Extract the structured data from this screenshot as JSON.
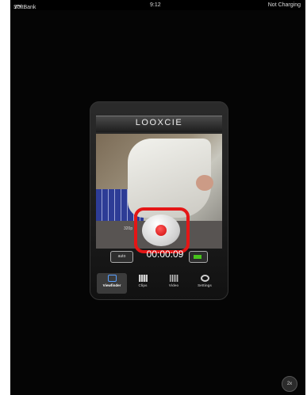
{
  "statusbar": {
    "carrier": "SoftBank",
    "time": "9:12",
    "right": "Not Charging"
  },
  "app": {
    "logo": "LOOXCIE",
    "resolution": "320p",
    "auto_label": "auto",
    "timecode": "00:00:09"
  },
  "tabs": [
    {
      "label": "Viewfinder",
      "icon": "viewfinder-icon",
      "active": true
    },
    {
      "label": "Clips",
      "icon": "clips-icon",
      "active": false
    },
    {
      "label": "Video",
      "icon": "video-icon",
      "active": false
    },
    {
      "label": "Settings",
      "icon": "settings-icon",
      "active": false
    }
  ],
  "zoom_badge": "2x",
  "colors": {
    "highlight": "#e41616",
    "record": "#cf0808",
    "battery": "#47c41b",
    "active_tab_icon": "#58a0ff"
  }
}
